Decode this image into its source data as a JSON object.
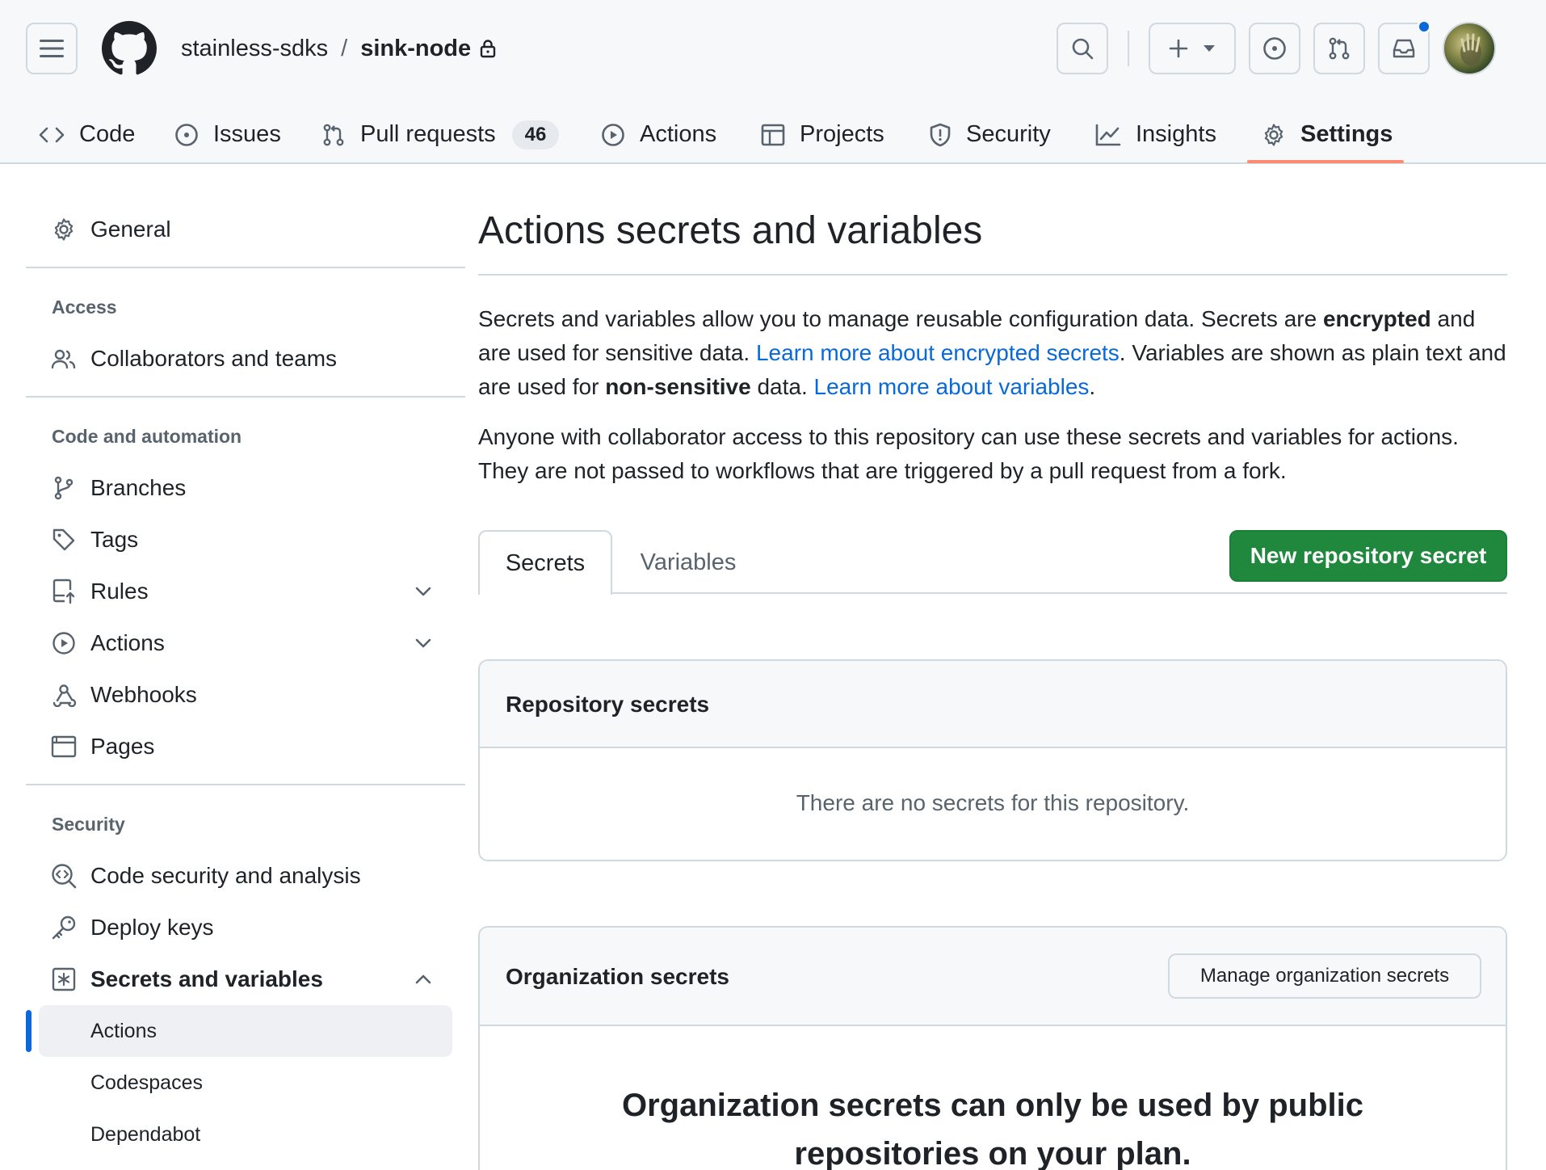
{
  "header": {
    "repo_owner": "stainless-sdks",
    "repo_separator": "/",
    "repo_name": "sink-node"
  },
  "repo_nav": {
    "tabs": [
      {
        "label": "Code",
        "icon": "code-icon"
      },
      {
        "label": "Issues",
        "icon": "issue-opened-icon"
      },
      {
        "label": "Pull requests",
        "icon": "git-pull-request-icon",
        "count": "46"
      },
      {
        "label": "Actions",
        "icon": "play-icon"
      },
      {
        "label": "Projects",
        "icon": "table-icon"
      },
      {
        "label": "Security",
        "icon": "shield-icon"
      },
      {
        "label": "Insights",
        "icon": "graph-icon"
      },
      {
        "label": "Settings",
        "icon": "gear-icon",
        "selected": true
      }
    ]
  },
  "sidebar": {
    "general": "General",
    "access_heading": "Access",
    "collaborators": "Collaborators and teams",
    "code_automation_heading": "Code and automation",
    "branches": "Branches",
    "tags": "Tags",
    "rules": "Rules",
    "actions": "Actions",
    "webhooks": "Webhooks",
    "pages": "Pages",
    "security_heading": "Security",
    "code_security": "Code security and analysis",
    "deploy_keys": "Deploy keys",
    "secrets_variables": "Secrets and variables",
    "sub_items": [
      "Actions",
      "Codespaces",
      "Dependabot"
    ]
  },
  "main": {
    "title": "Actions secrets and variables",
    "intro": {
      "p1_a": "Secrets and variables allow you to manage reusable configuration data. Secrets are ",
      "p1_b": "encrypted",
      "p1_c": " and are used for sensitive data. ",
      "p1_link1": "Learn more about encrypted secrets",
      "p1_d": ". Variables are shown as plain text and are used for ",
      "p1_e": "non-sensitive",
      "p1_f": " data. ",
      "p1_link2": "Learn more about variables",
      "p1_g": ".",
      "p2": "Anyone with collaborator access to this repository can use these secrets and variables for actions. They are not passed to workflows that are triggered by a pull request from a fork."
    },
    "tabs": {
      "secrets": "Secrets",
      "variables": "Variables"
    },
    "new_secret_button": "New repository secret",
    "repo_secrets": {
      "title": "Repository secrets",
      "empty": "There are no secrets for this repository."
    },
    "org_secrets": {
      "title": "Organization secrets",
      "manage_button": "Manage organization secrets",
      "message": "Organization secrets can only be used by public repositories on your plan."
    }
  },
  "colors": {
    "accent_blue": "#0969da",
    "primary_green": "#1f883d",
    "nav_underline": "#fd8c73",
    "notification_dot": "#0969da"
  }
}
